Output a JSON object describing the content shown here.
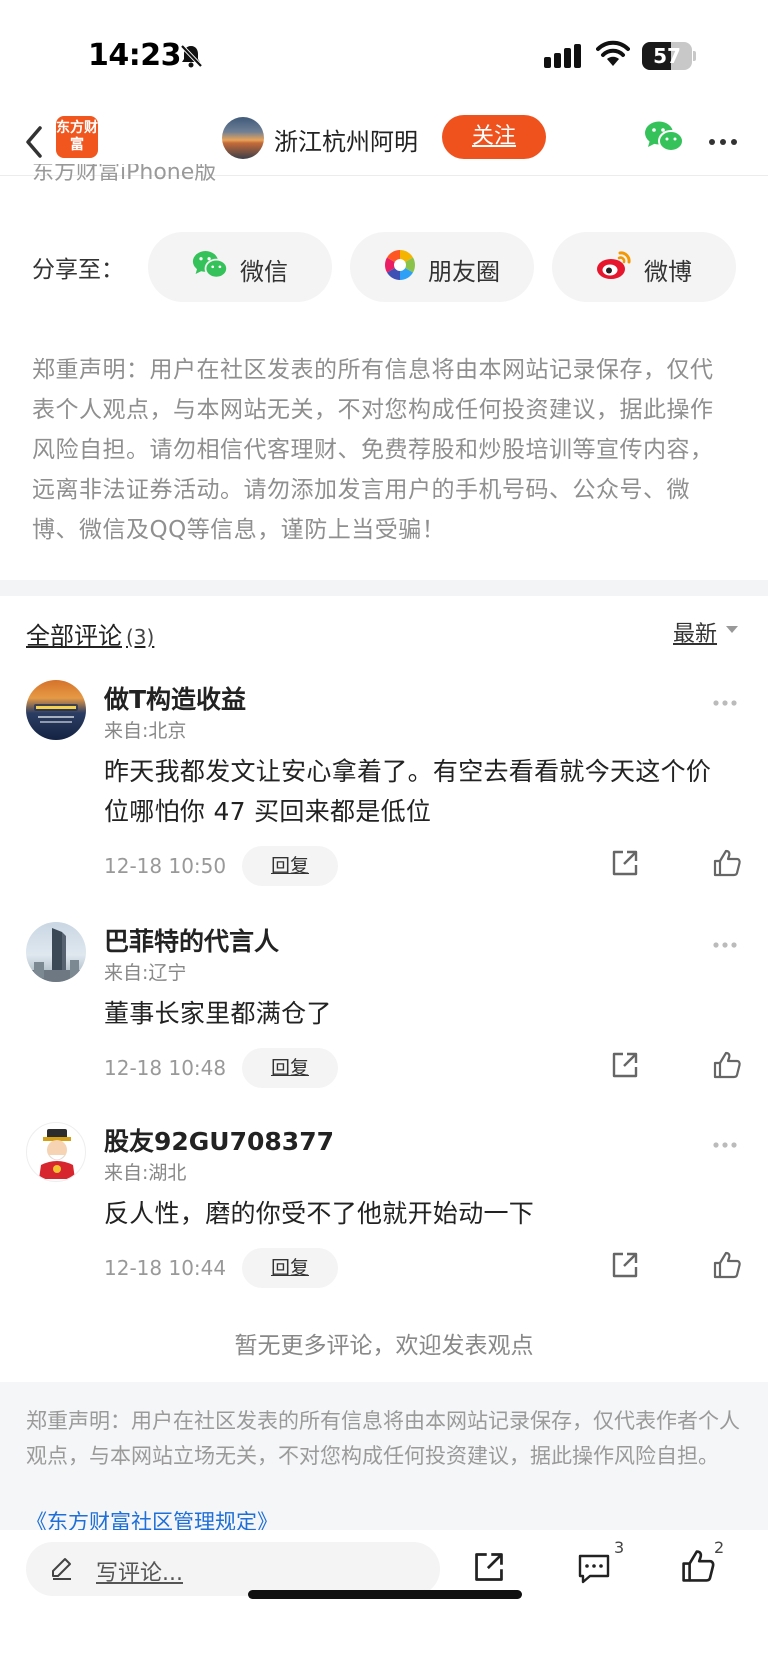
{
  "status_bar": {
    "time": "14:23",
    "battery": "57",
    "battery_level": 0.57
  },
  "header": {
    "logo_text": "东方财富",
    "user_name": "浙江杭州阿明",
    "follow_label": "关注"
  },
  "cut_text": "东方财富iPhone版",
  "share": {
    "label": "分享至：",
    "options": [
      {
        "label": "微信",
        "icon": "wechat-icon"
      },
      {
        "label": "朋友圈",
        "icon": "moments-icon"
      },
      {
        "label": "微博",
        "icon": "weibo-icon"
      }
    ]
  },
  "disclaimer_top": "郑重声明：用户在社区发表的所有信息将由本网站记录保存，仅代表个人观点，与本网站无关，不对您构成任何投资建议，据此操作风险自担。请勿相信代客理财、免费荐股和炒股培训等宣传内容，远离非法证券活动。请勿添加发言用户的手机号码、公众号、微博、微信及QQ等信息，谨防上当受骗！",
  "comments_section": {
    "title": "全部评论",
    "count": "(3)",
    "sort_label": "最新",
    "reply_label": "回复",
    "items": [
      {
        "name": "做T构造收益",
        "location": "来自:北京",
        "text": "昨天我都发文让安心拿着了。有空去看看就今天这个价位哪怕你 47 买回来都是低位",
        "time": "12-18 10:50"
      },
      {
        "name": "巴菲特的代言人",
        "location": "来自:辽宁",
        "text": "董事长家里都满仓了",
        "time": "12-18 10:48"
      },
      {
        "name": "股友92GU708377",
        "location": "来自:湖北",
        "text": "反人性，磨的你受不了他就开始动一下",
        "time": "12-18 10:44"
      }
    ],
    "no_more": "暂无更多评论，欢迎发表观点"
  },
  "disclaimer_bottom": "郑重声明：用户在社区发表的所有信息将由本网站记录保存，仅代表作者个人观点，与本网站立场无关，不对您构成任何投资建议，据此操作风险自担。",
  "rules_link": "《东方财富社区管理规定》",
  "bottom_bar": {
    "placeholder": "写评论...",
    "comment_count": "3",
    "like_count": "2"
  },
  "colors": {
    "accent": "#f0521e",
    "link": "#1f6fd8"
  }
}
